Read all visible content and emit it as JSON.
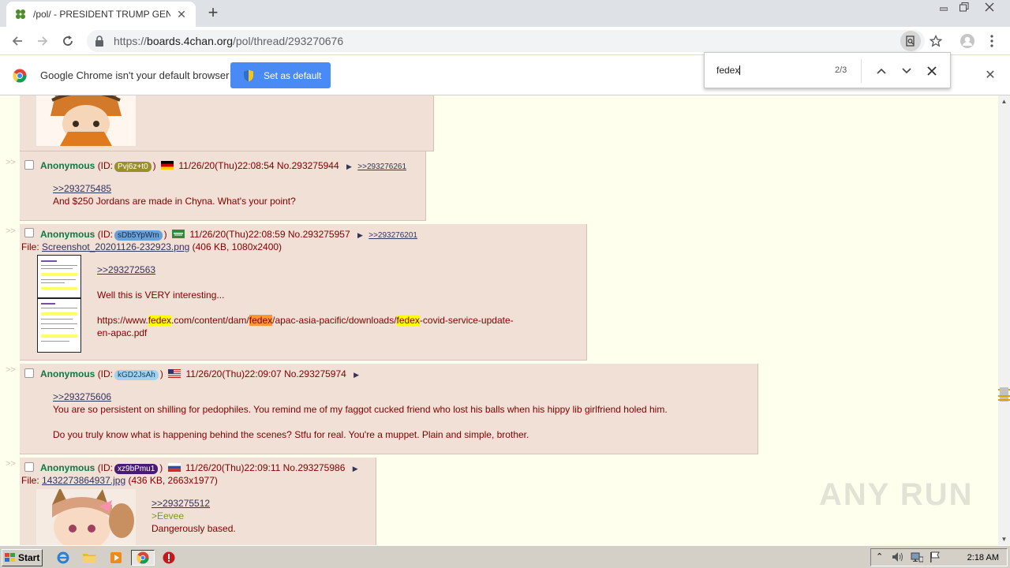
{
  "browser": {
    "tab_title": "/pol/ - PRESIDENT TRUMP GENERAL",
    "url_prefix": "https://",
    "url_domain": "boards.4chan.org",
    "url_path": "/pol/thread/293270676"
  },
  "infobar": {
    "message": "Google Chrome isn't your default browser",
    "button_label": "Set as default"
  },
  "findbar": {
    "query": "fedex",
    "count": "2/3"
  },
  "posts": [
    {
      "name": "Anonymous",
      "id_prefix": "(ID:",
      "id": "Pvj6z+t0",
      "id_suffix": ")",
      "datetime": "11/26/20(Thu)22:08:54",
      "no_label": "No.",
      "number": "293275944",
      "backlink": ">>293276261",
      "quote": ">>293275485",
      "text": "And $250 Jordans are made in Chyna. What's your point?"
    },
    {
      "name": "Anonymous",
      "id_prefix": "(ID:",
      "id": "sDb5YpWm",
      "id_suffix": ")",
      "datetime": "11/26/20(Thu)22:08:59",
      "no_label": "No.",
      "number": "293275957",
      "backlink": ">>293276201",
      "file_label": "File:",
      "file_name": "Screenshot_20201126-232923.png",
      "file_meta": "(406 KB, 1080x2400)",
      "quote": ">>293272563",
      "text": "Well this is VERY interesting...",
      "url_parts": [
        "https://www.",
        "fedex",
        ".com/content/dam/",
        "fedex",
        "/apac-asia-pacific/downloads/",
        "fedex",
        "-covid-service-update-"
      ],
      "url_tail": "en-apac.pdf"
    },
    {
      "name": "Anonymous",
      "id_prefix": "(ID:",
      "id": "kGD2JsAh",
      "id_suffix": ")",
      "datetime": "11/26/20(Thu)22:09:07",
      "no_label": "No.",
      "number": "293275974",
      "quote": ">>293275606",
      "text": "You are so persistent on shilling for pedophiles. You remind me of my faggot cucked friend who lost his balls when his hippy lib girlfriend holed him.",
      "text2": "Do you truly know what is happening behind the scenes? Stfu for real. You're a muppet. Plain and simple, brother."
    },
    {
      "name": "Anonymous",
      "id_prefix": "(ID:",
      "id": "xz9bPmu1",
      "id_suffix": ")",
      "datetime": "11/26/20(Thu)22:09:11",
      "no_label": "No.",
      "number": "293275986",
      "file_label": "File:",
      "file_name": "1432273864937.jpg",
      "file_meta": "(436 KB, 2663x1977)",
      "quote": ">>293275512",
      "greentext": ">Eevee",
      "text": "Dangerously based."
    }
  ],
  "side_arrows": ">>",
  "taskbar": {
    "start_label": "Start",
    "clock": "2:18 AM"
  },
  "watermark": "ANY RUN",
  "colors": {
    "page_bg": "#ffffee",
    "post_bg": "#f0e0d6",
    "name": "#117743",
    "text": "#800000",
    "link": "#34345c",
    "find_highlight": "#ffff00",
    "find_active": "#ff9632",
    "chrome_blue": "#4a8af4"
  },
  "icons": {
    "tab_favicon": "4chan-clover-icon",
    "find_prev": "chevron-up-icon",
    "find_next": "chevron-down-icon"
  }
}
